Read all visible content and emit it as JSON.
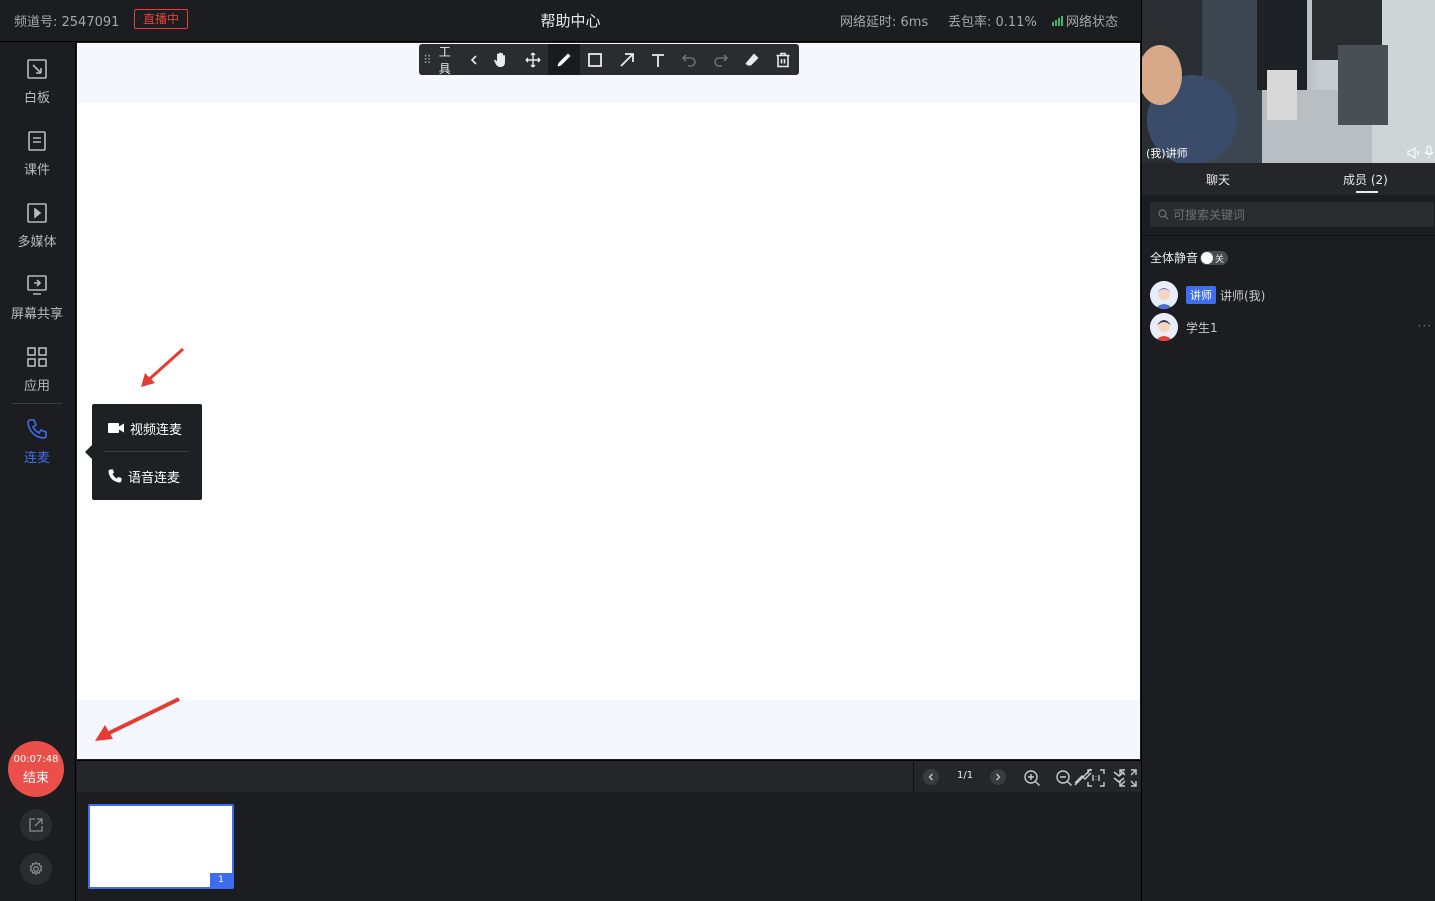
{
  "header": {
    "channel": "频道号: 2547091",
    "live_status": "直播中",
    "title": "帮助中心",
    "latency": "网络延时: 6ms",
    "packet_loss": "丢包率: 0.11%",
    "network_status": "网络状态"
  },
  "sidebar": {
    "items": [
      {
        "label": "白板"
      },
      {
        "label": "课件"
      },
      {
        "label": "多媒体"
      },
      {
        "label": "屏幕共享"
      },
      {
        "label": "应用"
      },
      {
        "label": "连麦"
      }
    ],
    "end_time": "00:07:48",
    "end_label": "结束"
  },
  "toolbar": {
    "label": "工具"
  },
  "mic_popup": {
    "video_label": "视频连麦",
    "audio_label": "语音连麦"
  },
  "pager": {
    "page": "1/1"
  },
  "thumbnail": {
    "number": "1"
  },
  "video": {
    "name": "(我)讲师"
  },
  "tabs": {
    "chat": "聊天",
    "members": "成员 (2)"
  },
  "search": {
    "placeholder": "可搜索关键词"
  },
  "members_panel": {
    "mute_all_label": "全体静音",
    "toggle_state": "关",
    "members": [
      {
        "role": "讲师",
        "name": "讲师(我)"
      },
      {
        "name": "学生1"
      }
    ]
  },
  "colors": {
    "accent": "#3f6df0",
    "live_red": "#e5413a",
    "end_button": "#ea4f4a",
    "signal_green": "#45b36a"
  }
}
